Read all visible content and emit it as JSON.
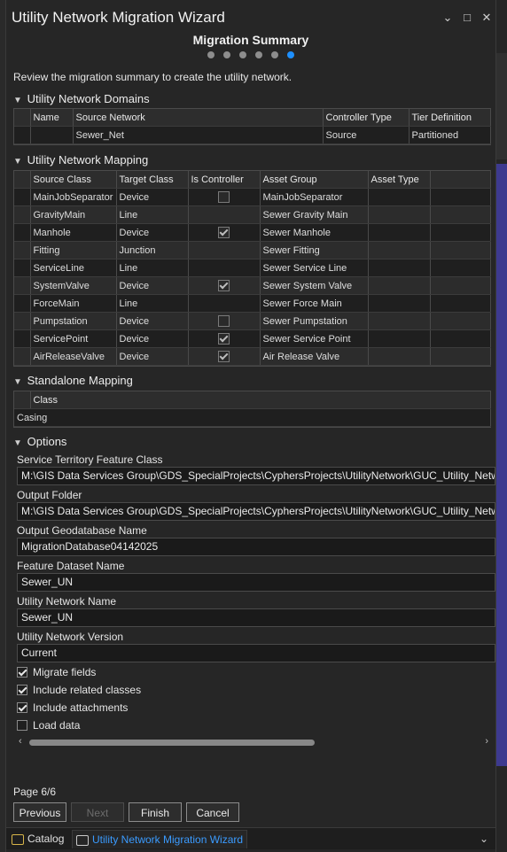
{
  "window": {
    "title": "Utility Network Migration Wizard",
    "buttons": [
      "⌄",
      "□",
      "✕"
    ]
  },
  "wizard": {
    "step_title": "Migration Summary",
    "steps_total": 6,
    "current_step": 6,
    "intro": "Review the migration summary to create the utility network."
  },
  "domains": {
    "section_label": "Utility Network Domains",
    "columns": [
      "Name",
      "Source Network",
      "Controller Type",
      "Tier Definition"
    ],
    "rows": [
      [
        "",
        "Sewer_Net",
        "Source",
        "Partitioned"
      ]
    ]
  },
  "mapping": {
    "section_label": "Utility Network Mapping",
    "columns": [
      "Source Class",
      "Target Class",
      "Is Controller",
      "Asset Group",
      "Asset Type"
    ],
    "rows": [
      {
        "source": "MainJobSeparator",
        "target": "Device",
        "controller": false,
        "controller_visible": true,
        "group": "MainJobSeparator",
        "type": ""
      },
      {
        "source": "GravityMain",
        "target": "Line",
        "controller": false,
        "controller_visible": false,
        "group": "Sewer Gravity Main",
        "type": ""
      },
      {
        "source": "Manhole",
        "target": "Device",
        "controller": true,
        "controller_visible": true,
        "group": "Sewer Manhole",
        "type": ""
      },
      {
        "source": "Fitting",
        "target": "Junction",
        "controller": false,
        "controller_visible": false,
        "group": "Sewer Fitting",
        "type": ""
      },
      {
        "source": "ServiceLine",
        "target": "Line",
        "controller": false,
        "controller_visible": false,
        "group": "Sewer Service Line",
        "type": ""
      },
      {
        "source": "SystemValve",
        "target": "Device",
        "controller": true,
        "controller_visible": true,
        "group": "Sewer System Valve",
        "type": ""
      },
      {
        "source": "ForceMain",
        "target": "Line",
        "controller": false,
        "controller_visible": false,
        "group": "Sewer Force Main",
        "type": ""
      },
      {
        "source": "Pumpstation",
        "target": "Device",
        "controller": false,
        "controller_visible": true,
        "group": "Sewer Pumpstation",
        "type": ""
      },
      {
        "source": "ServicePoint",
        "target": "Device",
        "controller": true,
        "controller_visible": true,
        "group": "Sewer Service Point",
        "type": ""
      },
      {
        "source": "AirReleaseValve",
        "target": "Device",
        "controller": true,
        "controller_visible": true,
        "group": "Air Release Valve",
        "type": ""
      }
    ]
  },
  "standalone": {
    "section_label": "Standalone Mapping",
    "columns": [
      "Class"
    ],
    "rows": [
      [
        "Casing"
      ]
    ]
  },
  "options": {
    "section_label": "Options",
    "service_territory_label": "Service Territory Feature Class",
    "service_territory_value": "M:\\GIS Data Services Group\\GDS_SpecialProjects\\CyphersProjects\\UtilityNetwork\\GUC_Utility_Network",
    "output_folder_label": "Output Folder",
    "output_folder_value": "M:\\GIS Data Services Group\\GDS_SpecialProjects\\CyphersProjects\\UtilityNetwork\\GUC_Utility_Network",
    "gdb_name_label": "Output Geodatabase Name",
    "gdb_name_value": "MigrationDatabase04142025",
    "dataset_label": "Feature Dataset Name",
    "dataset_value": "Sewer_UN",
    "un_name_label": "Utility Network Name",
    "un_name_value": "Sewer_UN",
    "un_version_label": "Utility Network Version",
    "un_version_value": "Current",
    "checks": [
      {
        "label": "Migrate fields",
        "checked": true
      },
      {
        "label": "Include related classes",
        "checked": true
      },
      {
        "label": "Include attachments",
        "checked": true
      },
      {
        "label": "Load data",
        "checked": false
      }
    ]
  },
  "footer": {
    "page_info": "Page 6/6",
    "previous": "Previous",
    "next": "Next",
    "finish": "Finish",
    "cancel": "Cancel"
  },
  "tabs": {
    "catalog": "Catalog",
    "wizard": "Utility Network Migration Wizard",
    "overflow": "⌄"
  },
  "colors": {
    "accent": "#1e90ff",
    "tab_active_text": "#3a9bff"
  }
}
